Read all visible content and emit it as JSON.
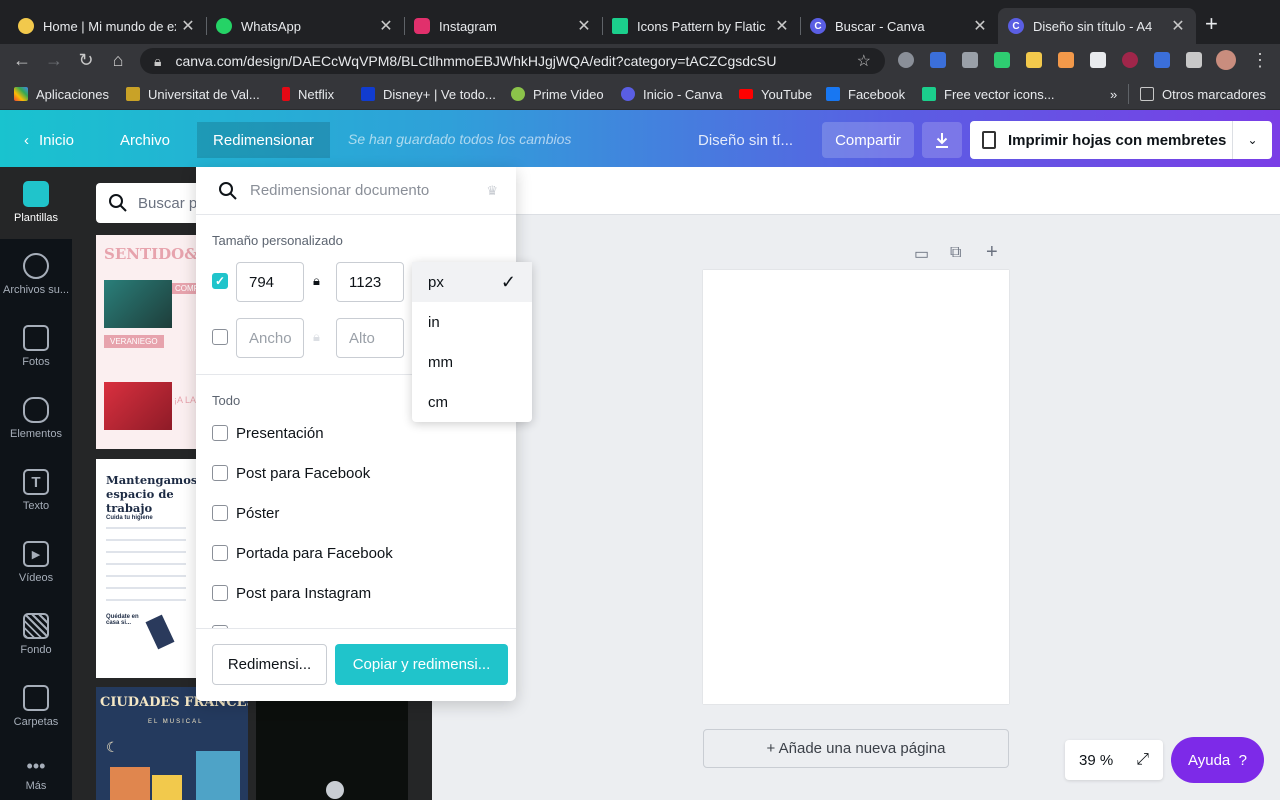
{
  "browser": {
    "tabs": [
      {
        "title": "Home | Mi mundo de ex",
        "color": "#f2c94c"
      },
      {
        "title": "WhatsApp",
        "color": "#25d366"
      },
      {
        "title": "Instagram",
        "color": "#e1306c"
      },
      {
        "title": "Icons Pattern by Flatic",
        "color": "#1bcf8c"
      },
      {
        "title": "Buscar - Canva",
        "color": "#5a5ee3"
      },
      {
        "title": "Diseño sin título - A4",
        "color": "#5a5ee3"
      }
    ],
    "url": "canva.com/design/DAECcWqVPM8/BLCtlhmmoEBJWhkHJgjWQA/edit?category=tACZCgsdcSU",
    "bookmarks": [
      {
        "label": "Aplicaciones"
      },
      {
        "label": "Universitat de Val..."
      },
      {
        "label": "Netflix"
      },
      {
        "label": "Disney+ | Ve todo..."
      },
      {
        "label": "Prime Video"
      },
      {
        "label": "Inicio - Canva"
      },
      {
        "label": "YouTube"
      },
      {
        "label": "Facebook"
      },
      {
        "label": "Free vector icons..."
      }
    ],
    "more": "»",
    "other_bookmarks": "Otros marcadores"
  },
  "header": {
    "home": "Inicio",
    "file": "Archivo",
    "resize": "Redimensionar",
    "saved": "Se han guardado todos los cambios",
    "title": "Diseño sin tí...",
    "share": "Compartir",
    "print": "Imprimir hojas con membretes"
  },
  "rail": [
    {
      "label": "Plantillas"
    },
    {
      "label": "Archivos su..."
    },
    {
      "label": "Fotos"
    },
    {
      "label": "Elementos"
    },
    {
      "label": "Texto"
    },
    {
      "label": "Vídeos"
    },
    {
      "label": "Fondo"
    },
    {
      "label": "Carpetas"
    },
    {
      "label": "Más"
    }
  ],
  "templates": {
    "search_placeholder": "Buscar p",
    "t1_title": "SENTIDO&ES",
    "t1_labels": [
      "COMPRA",
      "VERANIEGO",
      "¡A LA"
    ],
    "t2_title": "Mantengamos el espacio de trabajo",
    "t2_sub": "Cuida tu higiene",
    "t2_footer": "Quédate en casa si...",
    "t3_title": "CIUDADES FRANCESAS",
    "t3_sub": "EL MUSICAL"
  },
  "resize": {
    "search_placeholder": "Redimensionar documento",
    "custom_label": "Tamaño personalizado",
    "width": "794",
    "height": "1123",
    "width_placeholder": "Ancho",
    "height_placeholder": "Alto",
    "all_label": "Todo",
    "options": [
      "Presentación",
      "Post para Facebook",
      "Póster",
      "Portada para Facebook",
      "Post para Instagram"
    ],
    "resize_btn": "Redimensi...",
    "copy_btn": "Copiar y redimensi..."
  },
  "units": {
    "options": [
      "px",
      "in",
      "mm",
      "cm"
    ],
    "selected": "px"
  },
  "canvas": {
    "add_page": "+ Añade una nueva página",
    "zoom": "39 %",
    "help": "Ayuda  ?"
  }
}
